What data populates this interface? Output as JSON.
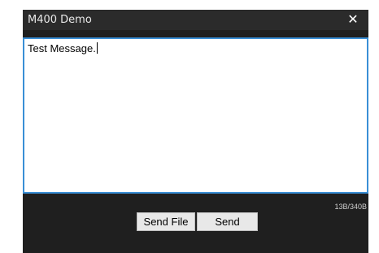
{
  "window": {
    "title": "M400 Demo",
    "close_glyph": "✕"
  },
  "editor": {
    "text": "Test Message."
  },
  "status": {
    "byte_counter": "13B/340B"
  },
  "actions": {
    "send_file_label": "Send File",
    "send_label": "Send"
  },
  "colors": {
    "titlebar": "#2b2b2b",
    "panel": "#1f1f1f",
    "editor_border": "#3a8fd6",
    "button_bg": "#e8e8e8"
  }
}
